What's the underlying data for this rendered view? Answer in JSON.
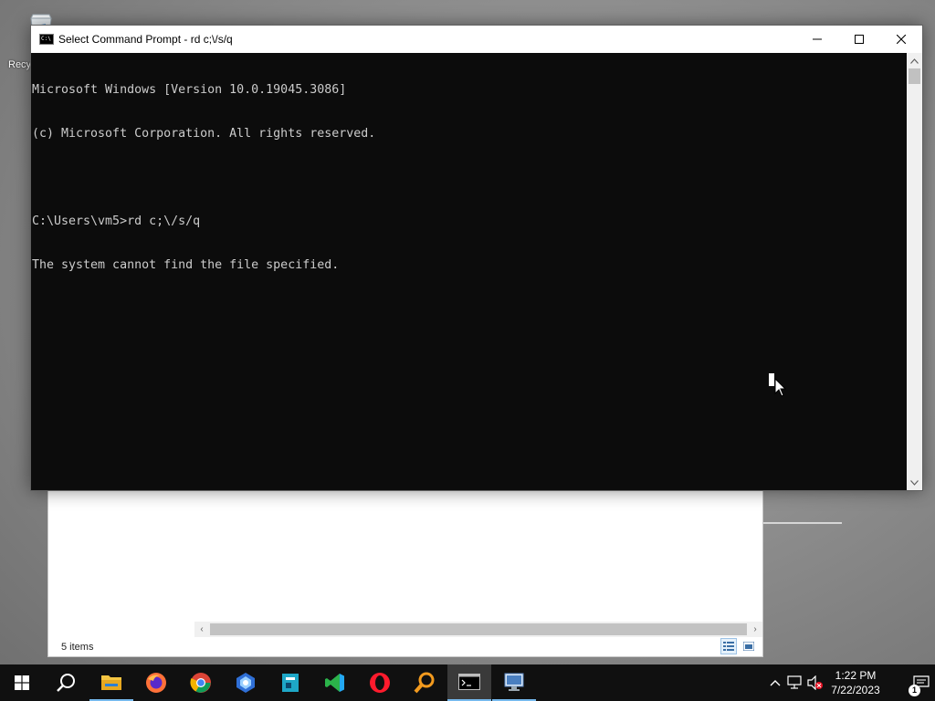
{
  "desktop": {
    "icons": [
      {
        "label": "Recy",
        "icon": "recycle-bin-icon"
      }
    ]
  },
  "explorer": {
    "status_text": "5 items",
    "scroll_left": "‹",
    "scroll_right": "›"
  },
  "cmd": {
    "title": "Select Command Prompt - rd  c;\\/s/q",
    "icon_text": "C:\\",
    "lines": [
      "Microsoft Windows [Version 10.0.19045.3086]",
      "(c) Microsoft Corporation. All rights reserved.",
      "",
      "C:\\Users\\vm5>rd c;\\/s/q",
      "The system cannot find the file specified."
    ],
    "colors": {
      "background": "#0c0c0c",
      "text": "#cccccc"
    }
  },
  "taskbar": {
    "items": [
      {
        "name": "start-button",
        "icon": "windows-logo-icon"
      },
      {
        "name": "search-button",
        "icon": "search-icon"
      },
      {
        "name": "file-explorer",
        "icon": "folder-icon"
      },
      {
        "name": "firefox",
        "icon": "firefox-icon"
      },
      {
        "name": "chrome",
        "icon": "chrome-icon"
      },
      {
        "name": "bing",
        "icon": "bing-icon"
      },
      {
        "name": "jupyter-editor",
        "icon": "editor-icon"
      },
      {
        "name": "vscode",
        "icon": "vscode-icon"
      },
      {
        "name": "opera",
        "icon": "opera-icon"
      },
      {
        "name": "search-tool",
        "icon": "magnifier-icon"
      },
      {
        "name": "command-prompt",
        "icon": "terminal-icon",
        "active": true
      },
      {
        "name": "remote-desktop",
        "icon": "remote-desktop-icon"
      }
    ],
    "clock": {
      "time": "1:22 PM",
      "date": "7/22/2023"
    },
    "notification_count": "1",
    "accent": "#76b9ed"
  }
}
